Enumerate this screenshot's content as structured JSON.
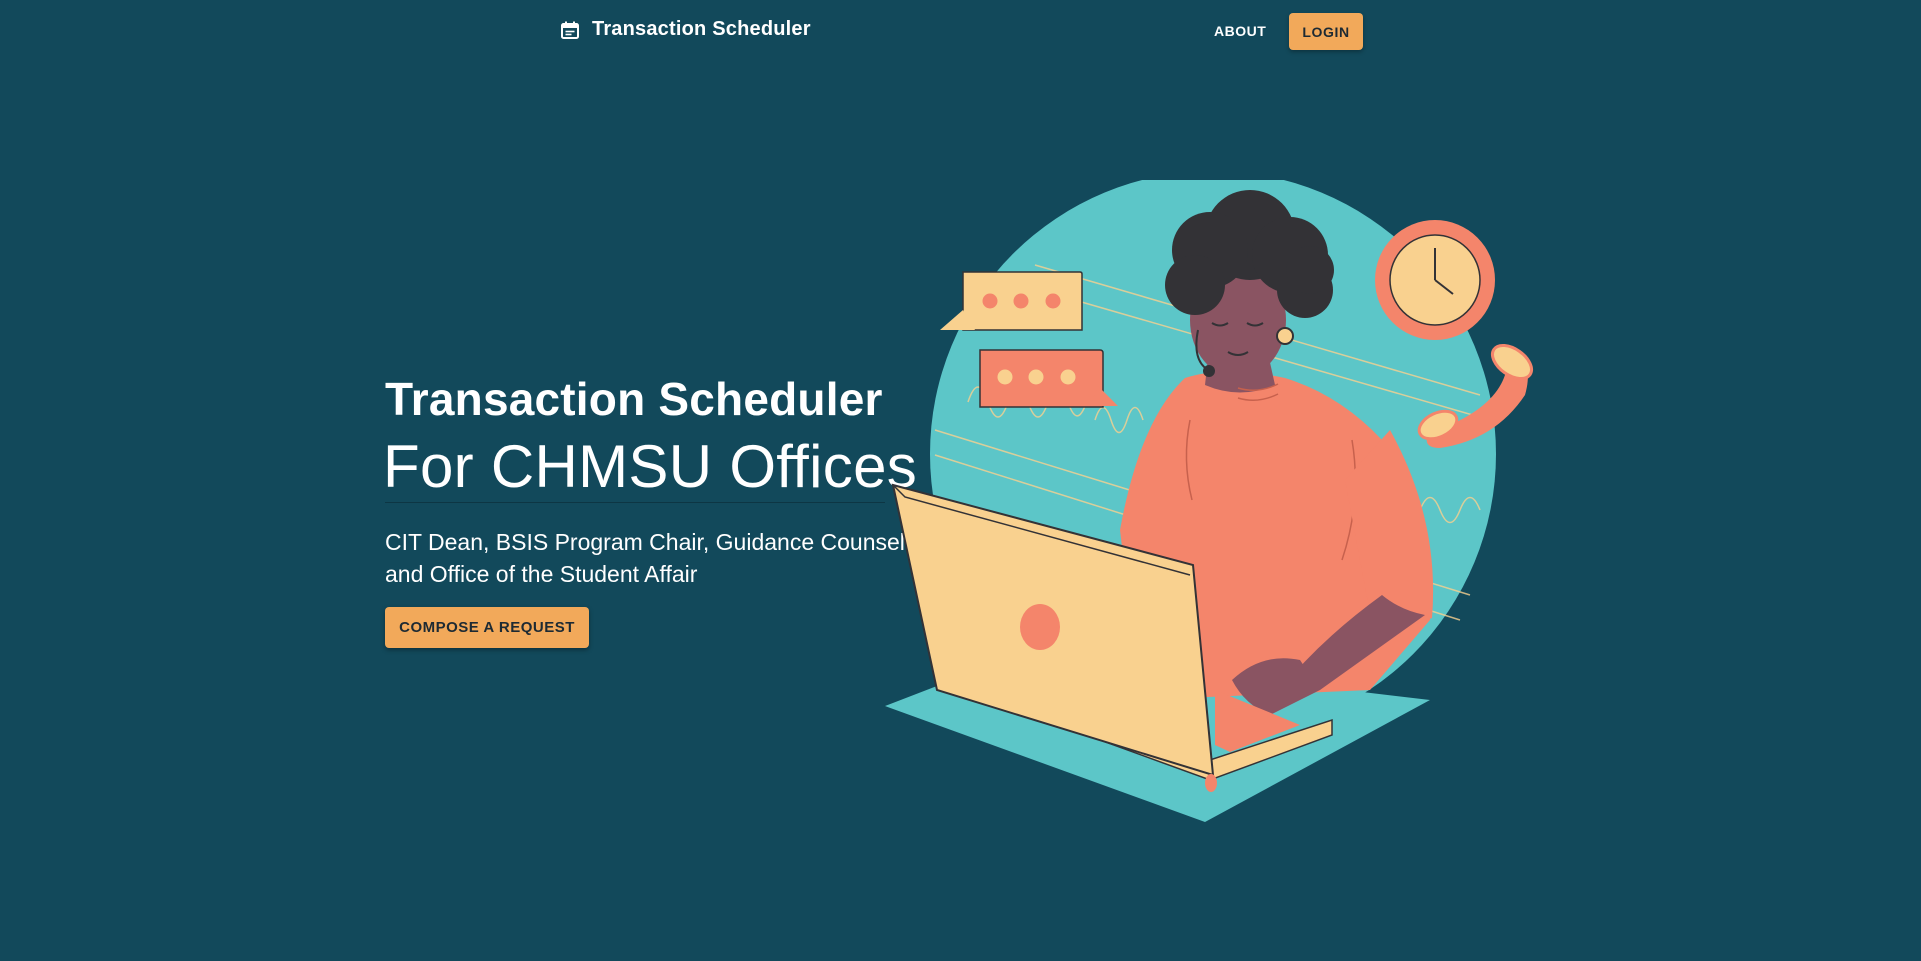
{
  "navbar": {
    "brand_icon": "calendar-icon",
    "brand_label": "Transaction Scheduler",
    "about_label": "ABOUT",
    "login_label": "LOGIN"
  },
  "hero": {
    "title": "Transaction Scheduler",
    "subtitle": "For CHMSU Offices",
    "description_line1": "CIT Dean, BSIS Program Chair, Guidance Counselor,",
    "description_line2": "and Office of the Student Affair",
    "cta_label": "COMPOSE A REQUEST"
  },
  "illustration": {
    "subject": "woman-with-headset-at-laptop",
    "elements": [
      "chat-bubble-icon",
      "chat-bubble-icon",
      "clock-icon",
      "phone-handset-icon",
      "laptop"
    ]
  },
  "colors": {
    "background": "#12495b",
    "accent": "#f2a95a",
    "teal": "#5cc6c8",
    "coral": "#f4856b",
    "cream": "#f9d18f"
  }
}
